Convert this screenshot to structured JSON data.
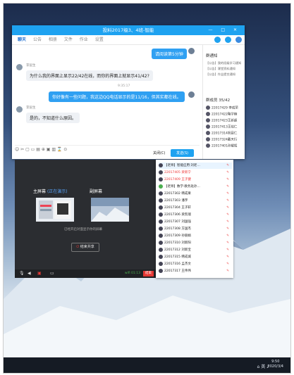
{
  "chat_window": {
    "title": "投料2017级3、4班-智能",
    "window_controls": "— □ ✕",
    "tabs": [
      "聊天",
      "公告",
      "相册",
      "文件",
      "作业",
      "设置"
    ],
    "messages": [
      {
        "side": "right",
        "text": "请阅读第5分钟"
      },
      {
        "side": "left",
        "sender": "李层生",
        "text": "为什么我的界面上显示22/42在线，而你的界面上就显示41/42?"
      },
      {
        "side": "time",
        "text": "9:35:17"
      },
      {
        "side": "right",
        "text": "你好像有一些问题，我这边QQ电话显示的是11/16，但其实都在线。"
      },
      {
        "side": "left",
        "sender": "李层生",
        "text": "是的，不知道什么原因。"
      }
    ],
    "toolbar_icons": "☺ ✂ ▢ ▭ ▤ ⊕ ▣ ▥ ⌛ ⊙",
    "close_label": "关闭(C)",
    "send_label": "发送(S)",
    "notice_title": "群通知",
    "notices": [
      "【公告】我的班级学习通知",
      "【公告】课堂资料通知",
      "【公告】作业提交通知"
    ],
    "members_title": "群成员 35/42",
    "members": [
      "22017429 李成荣",
      "22017422鞠学楠",
      "22017423王新超",
      "22017413王炫仁",
      "22017314祝目仁",
      "22017324戴天衍",
      "22017401孙耀辉"
    ]
  },
  "share_window": {
    "main_screen_label": "主屏幕",
    "main_screen_sub": "(正在演示)",
    "secondary_screen_label": "副屏幕",
    "hint": "已经开启对面显示你的屏幕",
    "end_button": "结束共享",
    "net_info": "wifi 01:13",
    "end_share": "结束"
  },
  "member_list": [
    {
      "name": "【老师】智能应用·刘老…",
      "color": "#222"
    },
    {
      "name": "22017405 梁新宁",
      "color": "#e33"
    },
    {
      "name": "22017409 王子健",
      "color": "#e33"
    },
    {
      "name": "【老师】数学·教务处孙…",
      "color": "#222"
    },
    {
      "name": "22017302 韩成果",
      "color": "#222"
    },
    {
      "name": "22017303 潘宇",
      "color": "#222"
    },
    {
      "name": "22017304 王子轩",
      "color": "#222"
    },
    {
      "name": "22017306 梁凯瑞",
      "color": "#222"
    },
    {
      "name": "22017307 刘国强",
      "color": "#222"
    },
    {
      "name": "22017308 方国杰",
      "color": "#222"
    },
    {
      "name": "22017309 孙丽娟",
      "color": "#222"
    },
    {
      "name": "22017310 刘新阳",
      "color": "#222"
    },
    {
      "name": "22017312 刘新宝",
      "color": "#222"
    },
    {
      "name": "22017315 韩成城",
      "color": "#222"
    },
    {
      "name": "22017316 孟杰文",
      "color": "#222"
    },
    {
      "name": "22017317 王伟伟",
      "color": "#222"
    }
  ],
  "taskbar": {
    "time": "9:50",
    "date": "2020/3/4",
    "tray": "⌂ 英 ♪"
  },
  "colors": {
    "accent": "#1ea2f0",
    "danger": "#e53935"
  }
}
